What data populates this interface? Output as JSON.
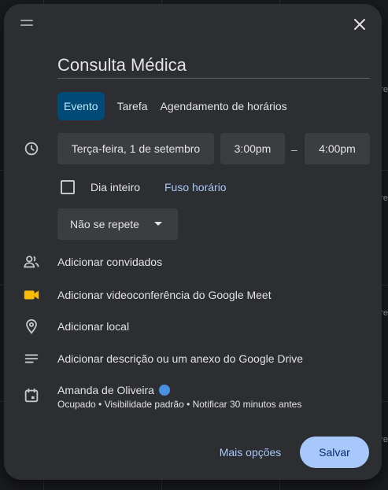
{
  "event_title": "Consulta Médica",
  "tabs": [
    {
      "label": "Evento"
    },
    {
      "label": "Tarefa"
    },
    {
      "label": "Agendamento de horários"
    }
  ],
  "date_time": {
    "date": "Terça-feira, 1 de setembro",
    "start": "3:00pm",
    "separator": "–",
    "end": "4:00pm"
  },
  "all_day": {
    "label": "Dia inteiro",
    "checked": false
  },
  "time_zone_link": "Fuso horário",
  "repeat": {
    "selected": "Não se repete"
  },
  "rows": {
    "guests": "Adicionar convidados",
    "meet": "Adicionar videoconferência do Google Meet",
    "location": "Adicionar local",
    "description": "Adicionar descrição ou um anexo do Google Drive"
  },
  "calendar": {
    "owner": "Amanda de Oliveira",
    "details": "Ocupado • Visibilidade padrão • Notificar 30 minutos antes",
    "color": "#4a90e2"
  },
  "actions": {
    "more_options": "Mais opções",
    "save": "Salvar"
  },
  "background_peek": [
    "ere",
    "ere",
    "ere",
    "ere",
    "ere"
  ],
  "colors": {
    "accent": "#a8c7fa",
    "active_tab": "#004a77",
    "meet_icon": "#fbbc04"
  }
}
